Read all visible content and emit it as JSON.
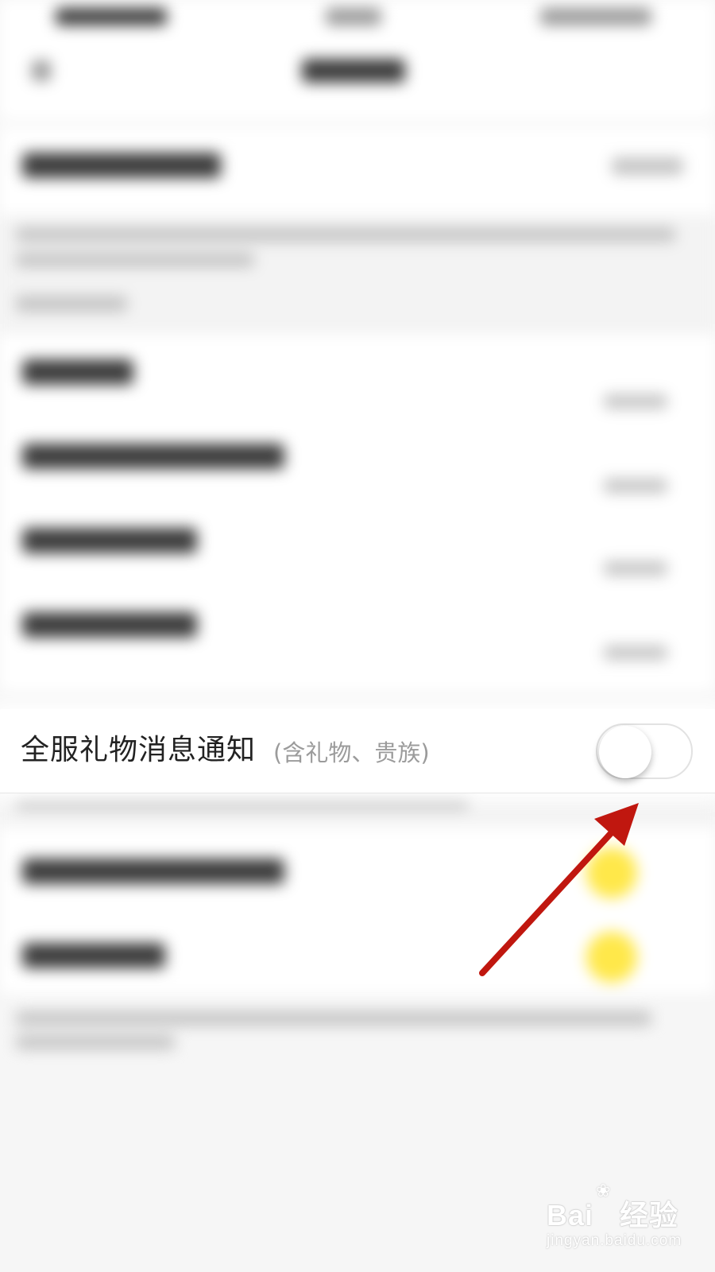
{
  "setting": {
    "title": "全服礼物消息通知",
    "subtitle": "(含礼物、贵族)",
    "toggle_state": "off"
  },
  "annotation": {
    "color": "#c0170f",
    "icon": "red-arrow-icon"
  },
  "watermark": {
    "brand": "Bai",
    "brand_suffix": "经验",
    "url": "jingyan.baidu.com"
  },
  "colors": {
    "background": "#f6f6f6",
    "row_background": "#ffffff",
    "title_text": "#222222",
    "subtitle_text": "#9b9b9b",
    "highlight_dot": "#ffe84a"
  }
}
